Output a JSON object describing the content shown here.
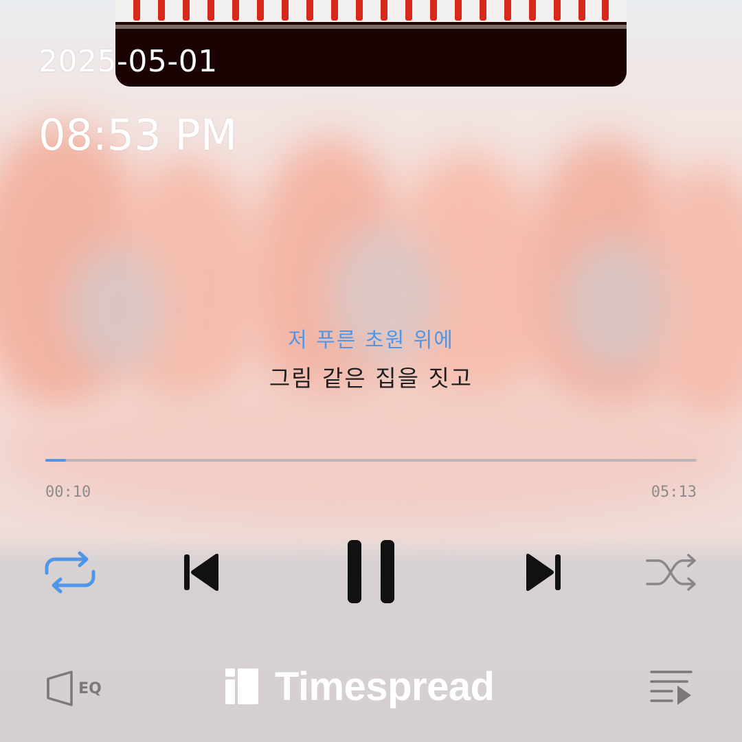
{
  "status": {
    "date": "2025-05-01",
    "time": "08:53 PM"
  },
  "lyrics": {
    "current": "저 푸른 초원 위에",
    "next": "그림 같은 집을 짓고"
  },
  "playback": {
    "elapsed": "00:10",
    "total": "05:13",
    "progress": 0.032,
    "state": "playing"
  },
  "controls": {
    "repeat_icon": "repeat-icon",
    "prev_icon": "skip-previous-icon",
    "pause_icon": "pause-icon",
    "next_icon": "skip-next-icon",
    "shuffle_icon": "shuffle-icon",
    "repeat_active": true
  },
  "footer": {
    "eq_label": "EQ",
    "brand": "Timespread",
    "queue_icon": "playlist-icon"
  },
  "colors": {
    "accent": "#4f96e8",
    "icon_dark": "#111111",
    "icon_muted": "#8a8686"
  }
}
